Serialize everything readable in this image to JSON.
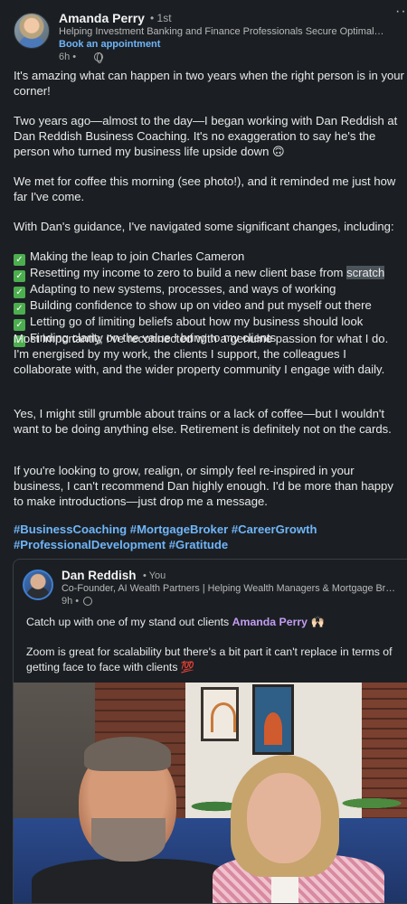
{
  "post": {
    "author": {
      "name": "Amanda Perry",
      "degree": "• 1st",
      "headline": "Helping Investment Banking and Finance Professionals Secure Optimal Mortgage Solutions",
      "cta": "Book an appointment",
      "time": "6h •"
    },
    "more_label": "···",
    "paragraphs": {
      "p1": "It's amazing what can happen in two years when the right person is in your corner!",
      "p2": "Two years ago—almost to the day—I began working with Dan Reddish at Dan Reddish Business Coaching. It's no exaggeration to say he's the person who turned my business life upside down 🙃",
      "p3": "We met for coffee this morning (see photo!), and it reminded me just how far I've come.",
      "p4": "With Dan's guidance, I've navigated some significant changes, including:",
      "p5": "Most importantly, I've reconnected with a genuine passion for what I do. I'm energised by my work, the clients I support, the colleagues I collaborate with, and the wider property community I engage with daily.",
      "p6": "Yes, I might still grumble about trains or a lack of coffee—but I wouldn't want to be doing anything else. Retirement is definitely not on the cards.",
      "p7": "If you're looking to grow, realign, or simply feel re-inspired in your business, I can't recommend Dan highly enough. I'd be more than happy to make introductions—just drop me a message."
    },
    "checklist": [
      "Making the leap to join Charles Cameron",
      "Resetting my income to zero to build a new client base from ",
      "Adapting to new systems, processes, and ways of working",
      "Building confidence to show up on video and put myself out there",
      "Letting go of limiting beliefs about how my business should look",
      "Finding clarity on the value I bring to my clients"
    ],
    "checklist_highlight": "scratch",
    "hashtags_line1": "#BusinessCoaching #MortgageBroker #CareerGrowth",
    "hashtags_line2": "#ProfessionalDevelopment #Gratitude"
  },
  "shared": {
    "name": "Dan Reddish",
    "you": "• You",
    "headline": "Co-Founder, AI Wealth Partners | Helping Wealth Managers & Mortgage Brokers",
    "time": "9h •",
    "text1_pre": "Catch up with one of my stand out clients ",
    "text1_mention": "Amanda Perry",
    "text1_emoji": " 🙌🏻",
    "text2": "Zoom is great for scalability but there's a bit part it can't replace in terms of getting face to face with clients 💯"
  },
  "colors": {
    "background": "#1b1f23",
    "link": "#70b5f9",
    "mention": "#c39cf2",
    "check": "#4cae4f"
  }
}
